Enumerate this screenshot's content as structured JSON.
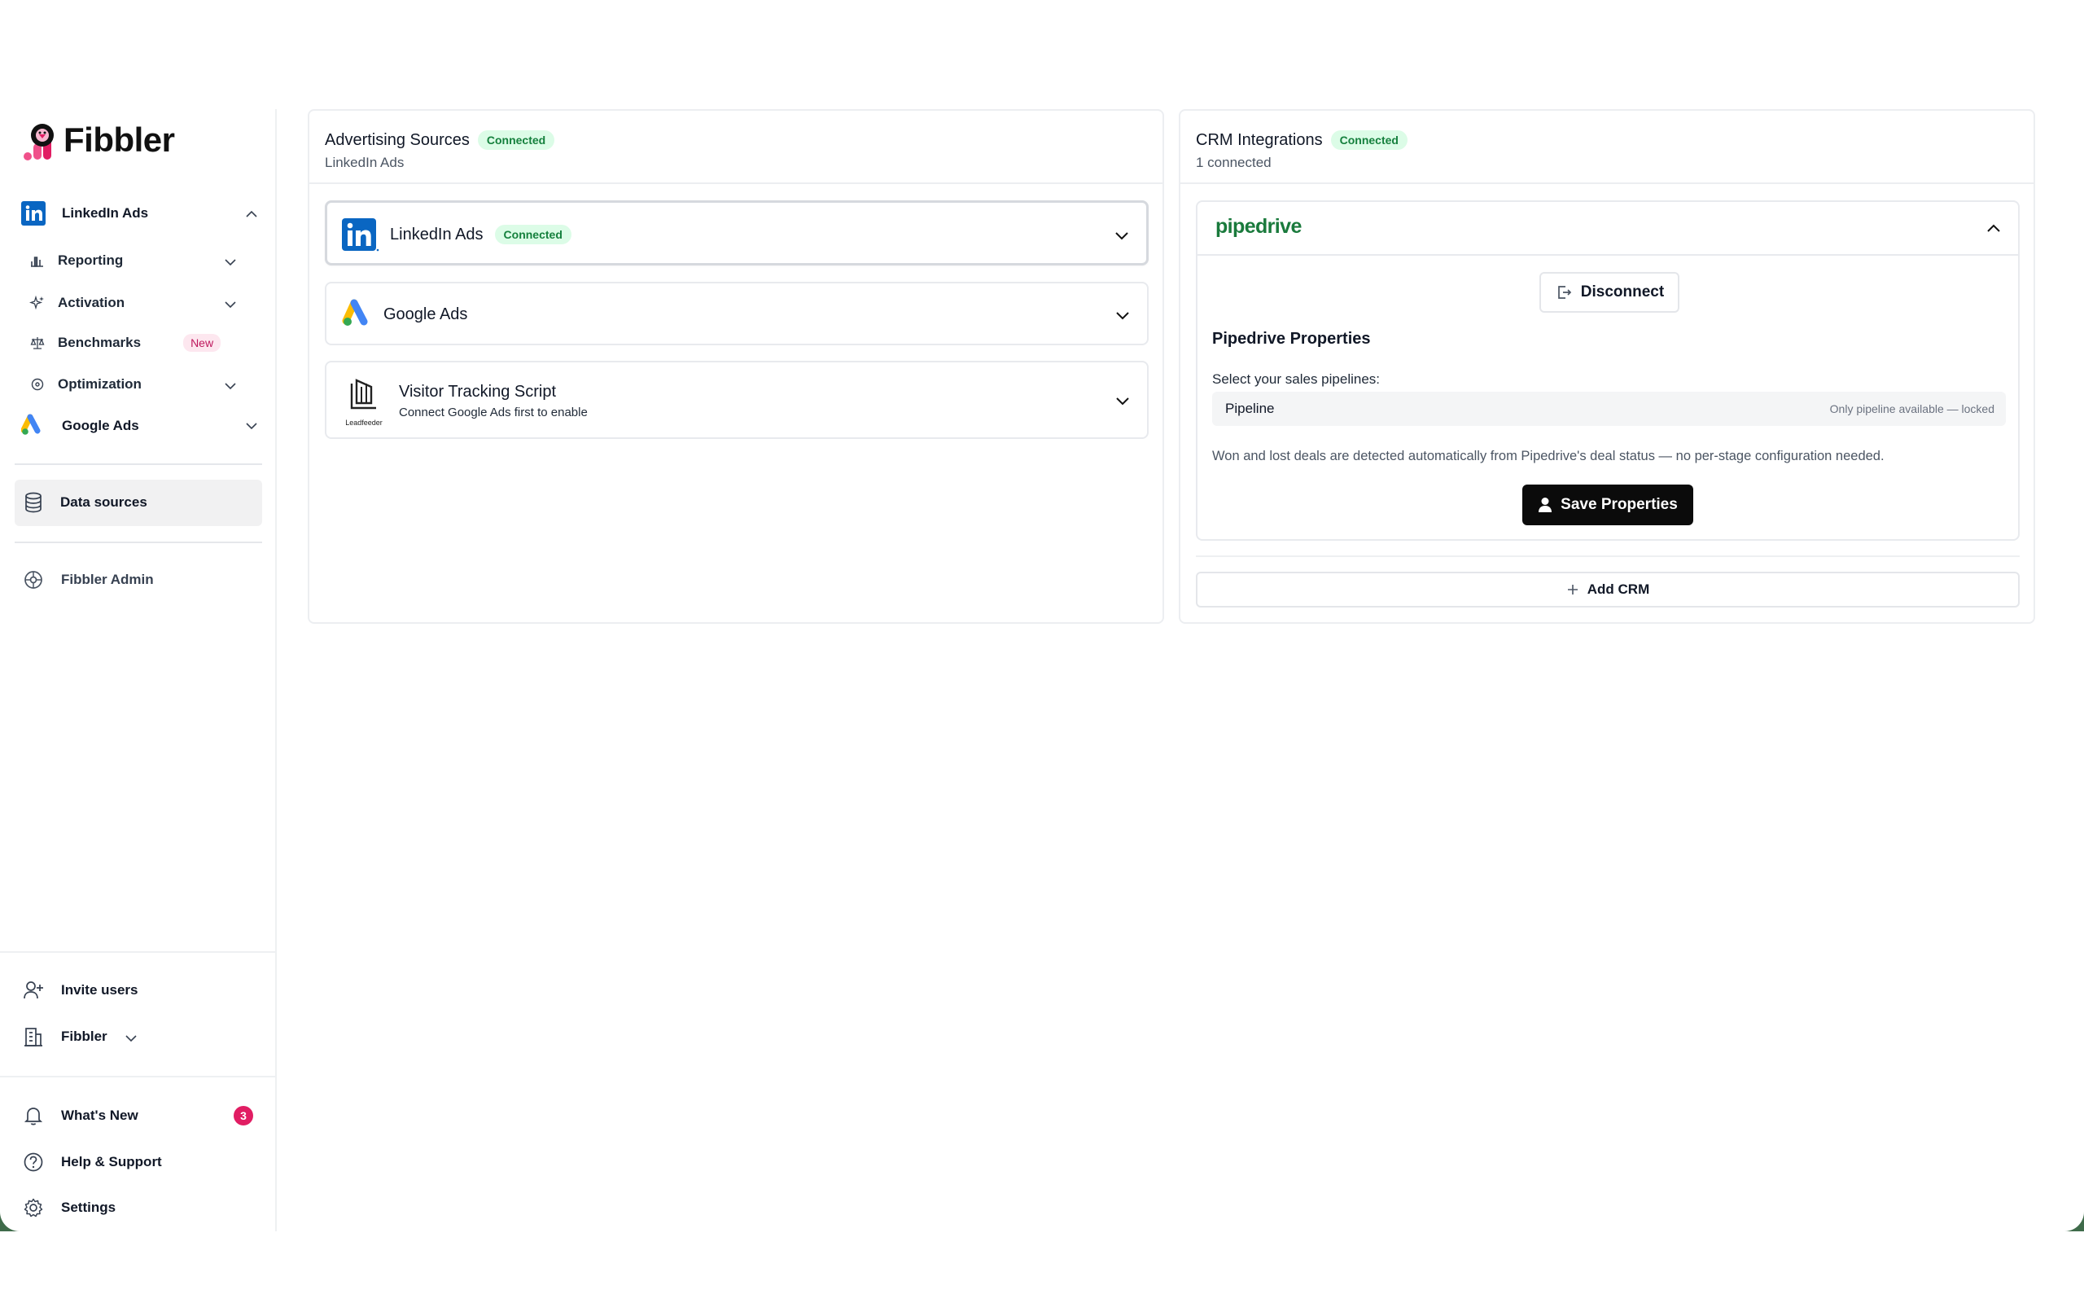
{
  "brand": {
    "name": "Fibbler"
  },
  "sidebar": {
    "linkedin_ads": "LinkedIn Ads",
    "reporting": "Reporting",
    "activation": "Activation",
    "benchmarks": "Benchmarks",
    "benchmarks_badge": "New",
    "optimization": "Optimization",
    "google_ads": "Google Ads",
    "data_sources": "Data sources",
    "fibbler_admin": "Fibbler Admin",
    "invite_users": "Invite users",
    "workspace": "Fibbler",
    "whats_new": "What's New",
    "whats_new_count": "3",
    "help_support": "Help & Support",
    "settings": "Settings"
  },
  "advertising": {
    "title": "Advertising Sources",
    "status": "Connected",
    "subtitle": "LinkedIn Ads",
    "sources": [
      {
        "name": "LinkedIn Ads",
        "status": "Connected"
      },
      {
        "name": "Google Ads"
      },
      {
        "name": "Visitor Tracking Script",
        "description": "Connect Google Ads first to enable",
        "logo_caption": "Leadfeeder"
      }
    ]
  },
  "crm": {
    "title": "CRM Integrations",
    "status": "Connected",
    "subtitle": "1 connected",
    "provider": "pipedrive",
    "disconnect_label": "Disconnect",
    "properties_title": "Pipedrive Properties",
    "pipelines_label": "Select your sales pipelines:",
    "pipeline_value": "Pipeline",
    "pipeline_note": "Only pipeline available — locked",
    "info_text": "Won and lost deals are detected automatically from Pipedrive's deal status — no per-stage configuration needed.",
    "save_label": "Save Properties",
    "add_crm_label": "Add CRM"
  },
  "colors": {
    "accent_green": "#15803d",
    "brand_pink": "#e11d63",
    "linkedin_blue": "#0a66c2",
    "pipedrive_green": "#1a7a3c"
  }
}
